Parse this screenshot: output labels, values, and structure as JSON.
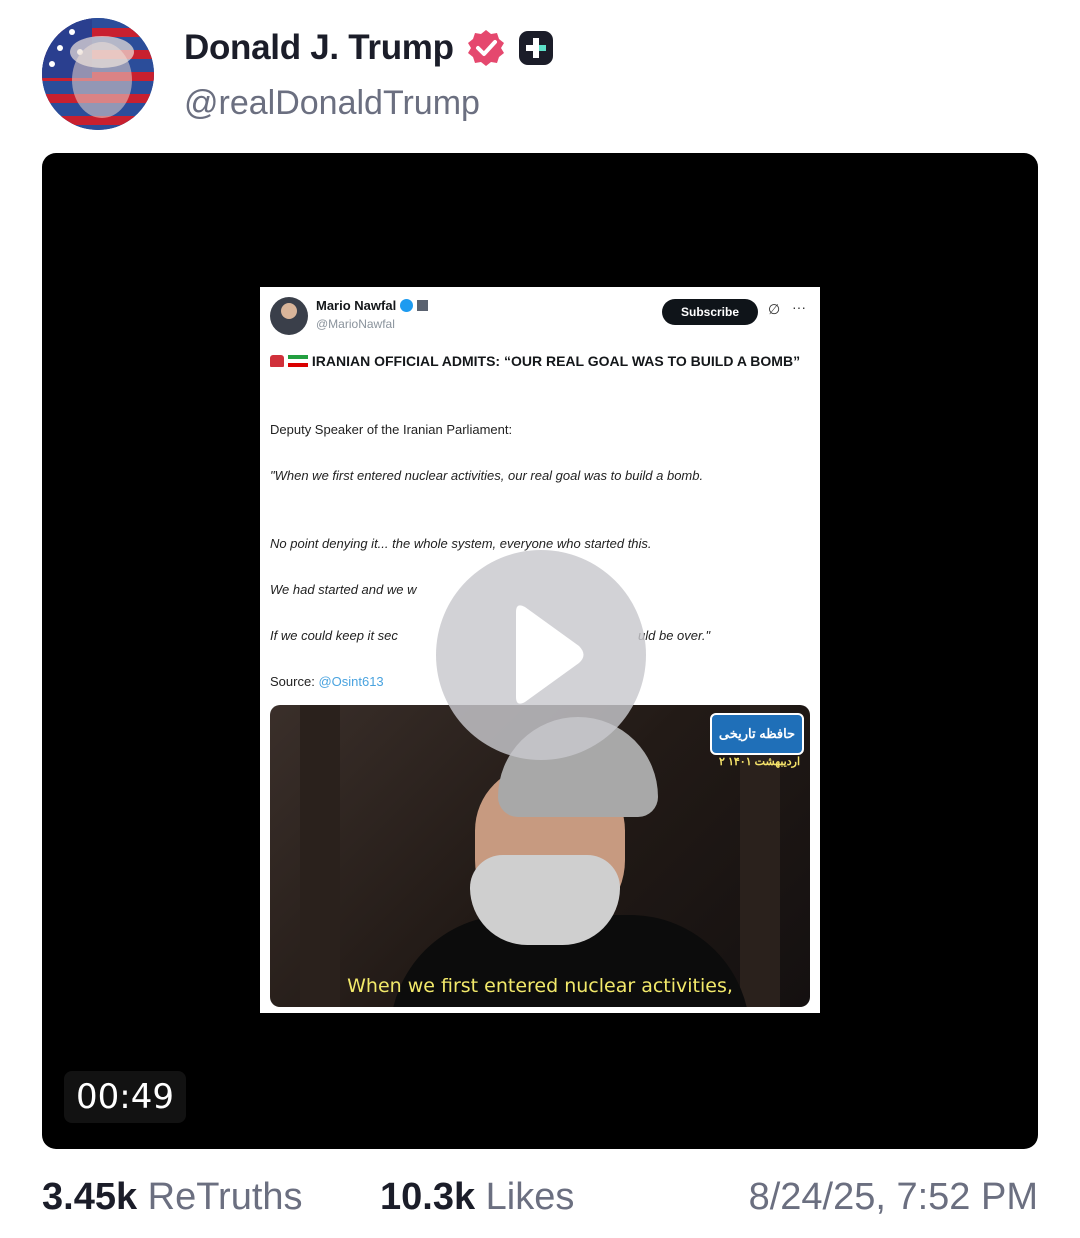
{
  "post": {
    "display_name": "Donald J. Trump",
    "handle": "@realDonaldTrump",
    "avatar_icon": "avatar-flag-portrait",
    "verified_icon": "verified-badge-icon",
    "plus_icon": "truth-plus-icon",
    "accent_color": "#e5486e"
  },
  "video": {
    "duration": "00:49",
    "play_icon": "play-icon",
    "thumbnail": {
      "author_name": "Mario Nawfal",
      "author_handle": "@MarioNawfal",
      "subscribe_label": "Subscribe",
      "more_label": "···",
      "grok_label": "∅",
      "headline": "IRANIAN OFFICIAL ADMITS: “OUR REAL GOAL WAS TO BUILD A BOMB”",
      "paragraph1": "Deputy Speaker of the Iranian Parliament:",
      "paragraph2": "\"When we first entered nuclear activities, our real goal was to build a bomb.",
      "paragraph3": "No point denying it... the whole system, everyone who started this.",
      "paragraph4": "We had started and we w",
      "paragraph5a": "If we could keep it sec",
      "paragraph5b": "uld be over.\"",
      "source_label": "Source:",
      "source_link": "@Osint613",
      "channel_logo": "حافظه تاریخی",
      "channel_date": "۲ اردیبهشت ۱۴۰۱",
      "subtitle": "When we first entered nuclear activities,"
    }
  },
  "stats": {
    "retruths_count": "3.45k",
    "retruths_label": "ReTruths",
    "likes_count": "10.3k",
    "likes_label": "Likes",
    "timestamp": "8/24/25, 7:52 PM"
  }
}
